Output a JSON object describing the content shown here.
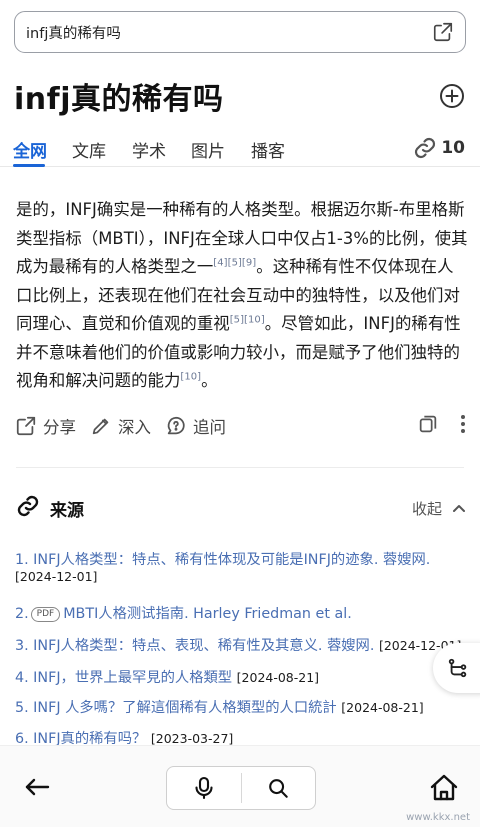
{
  "search": {
    "value": "infj真的稀有吗"
  },
  "title": "infj真的稀有吗",
  "tabs": [
    "全网",
    "文库",
    "学术",
    "图片",
    "播客"
  ],
  "link_count": "10",
  "answer": {
    "p1": "是的，INFJ确实是一种稀有的人格类型。根据迈尔斯-布里格斯类型指标（MBTI），INFJ在全球人口中仅占1-3%的比例，使其成为最稀有的人格类型之一",
    "c1": "[4][5][9]",
    "p2": "。这种稀有性不仅体现在人口比例上，还表现在他们在社会互动中的独特性，以及他们对同理心、直觉和价值观的重视",
    "c2": "[5][10]",
    "p3": "。尽管如此，INFJ的稀有性并不意味着他们的价值或影响力较小，而是赋予了他们独特的视角和解决问题的能力",
    "c3": "[10]",
    "p4": "。"
  },
  "actions": {
    "share": "分享",
    "deepen": "深入",
    "ask": "追问"
  },
  "sources": {
    "title": "来源",
    "collapse": "收起",
    "items": [
      {
        "text": "1. INFJ人格类型：特点、稀有性体现及可能是INFJ的迹象. 蓉嫂网.",
        "date": "[2024-12-01]"
      },
      {
        "text": "2.",
        "badge": "PDF",
        "text2": "MBTI人格测试指南. Harley Friedman et al.",
        "date": ""
      },
      {
        "text": "3. INFJ人格类型：特点、表现、稀有性及其意义. 蓉嫂网.",
        "date": "[2024-12-01]"
      },
      {
        "text": "4. INFJ，世界上最罕見的人格類型",
        "date": "[2024-08-21]"
      },
      {
        "text": "5. INFJ 人多嗎？了解這個稀有人格類型的人口統計",
        "date": "[2024-08-21]"
      },
      {
        "text": "6. INFJ真的稀有吗？",
        "date": "[2023-03-27]"
      }
    ]
  },
  "watermark": "www.kkx.net",
  "colors": {
    "accent": "#1a64d6",
    "link": "#4a6fb3"
  }
}
